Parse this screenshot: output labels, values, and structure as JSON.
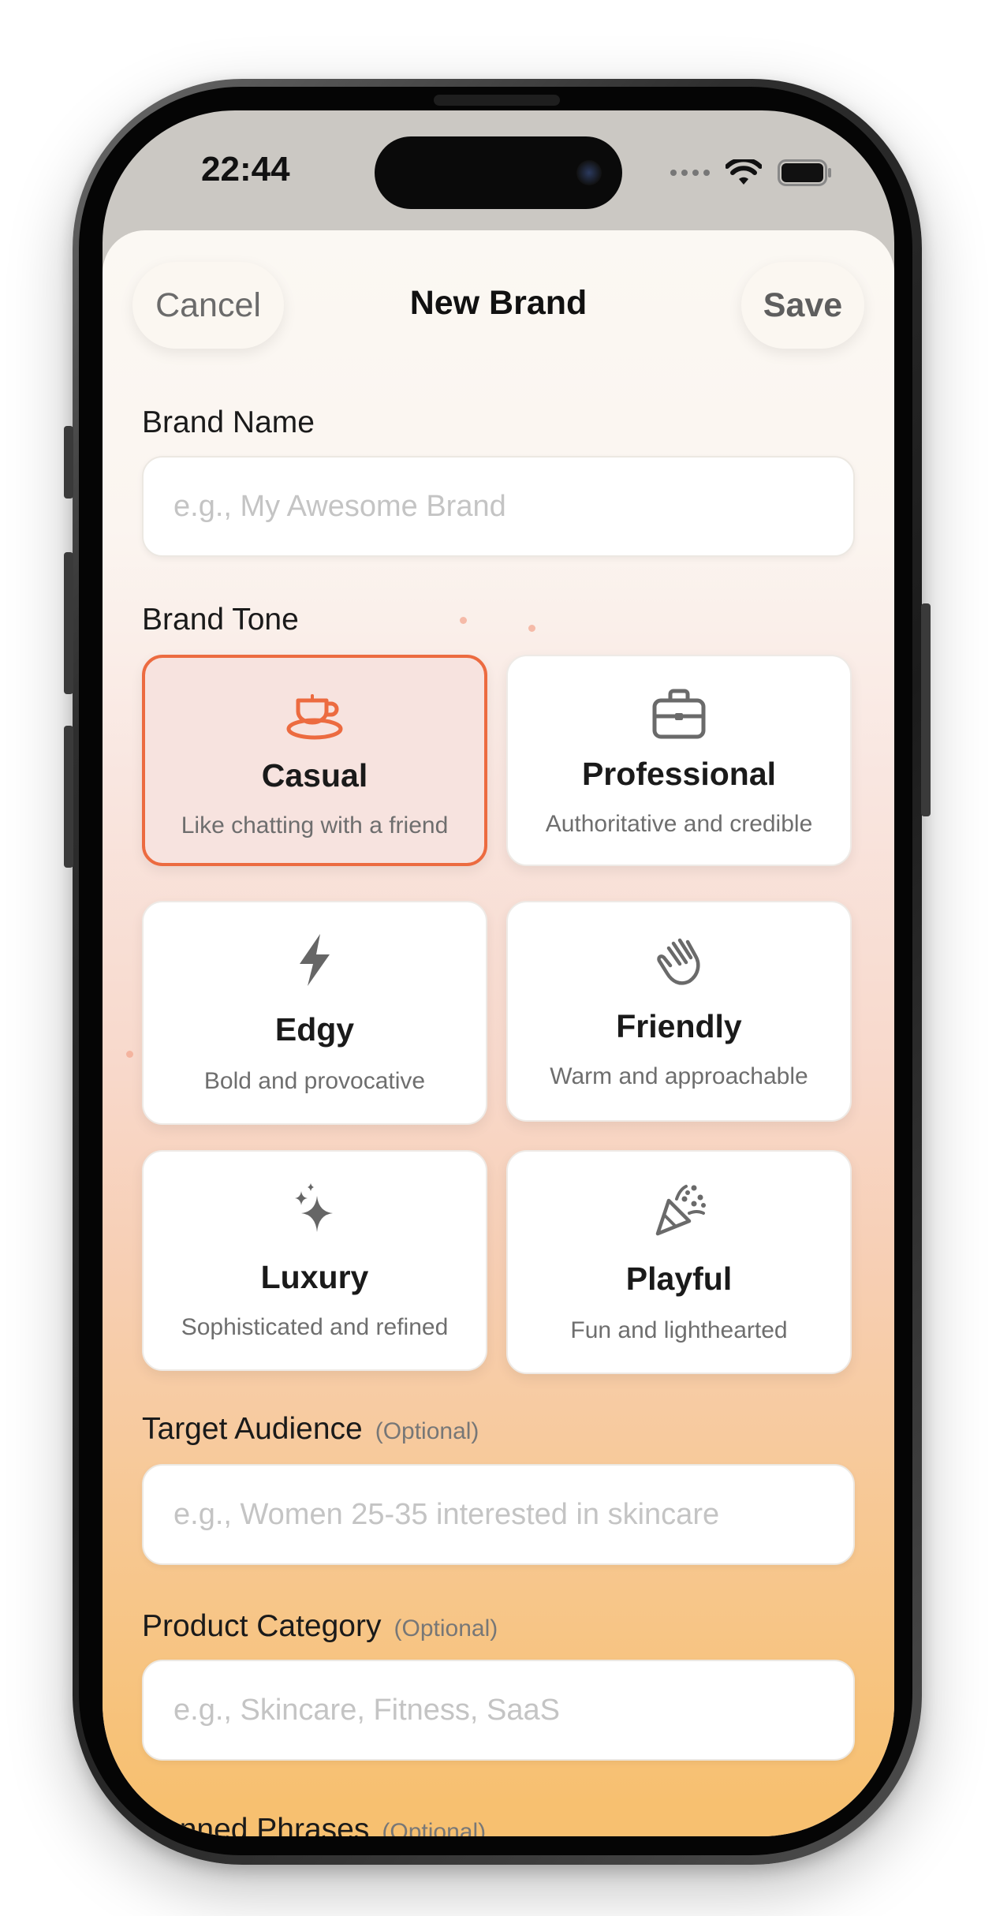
{
  "status": {
    "time": "22:44"
  },
  "header": {
    "cancel_label": "Cancel",
    "title": "New Brand",
    "save_label": "Save"
  },
  "brand_name": {
    "label": "Brand Name",
    "placeholder": "e.g., My Awesome Brand"
  },
  "brand_tone": {
    "label": "Brand Tone",
    "selected": "Casual",
    "options": [
      {
        "title": "Casual",
        "subtitle": "Like chatting with a friend",
        "icon": "cup-icon"
      },
      {
        "title": "Professional",
        "subtitle": "Authoritative and credible",
        "icon": "briefcase-icon"
      },
      {
        "title": "Edgy",
        "subtitle": "Bold and provocative",
        "icon": "bolt-icon"
      },
      {
        "title": "Friendly",
        "subtitle": "Warm and approachable",
        "icon": "waving-hand-icon"
      },
      {
        "title": "Luxury",
        "subtitle": "Sophisticated and refined",
        "icon": "sparkles-icon"
      },
      {
        "title": "Playful",
        "subtitle": "Fun and lighthearted",
        "icon": "party-popper-icon"
      }
    ]
  },
  "target_audience": {
    "label": "Target Audience",
    "optional": "(Optional)",
    "placeholder": "e.g., Women 25-35 interested in skincare"
  },
  "product_category": {
    "label": "Product Category",
    "optional": "(Optional)",
    "placeholder": "e.g., Skincare, Fitness, SaaS"
  },
  "banned_phrases": {
    "label": "Banned Phrases",
    "optional": "(Optional)"
  },
  "colors": {
    "accent": "#ec6b40",
    "selected_bg": "#f7e3df"
  }
}
